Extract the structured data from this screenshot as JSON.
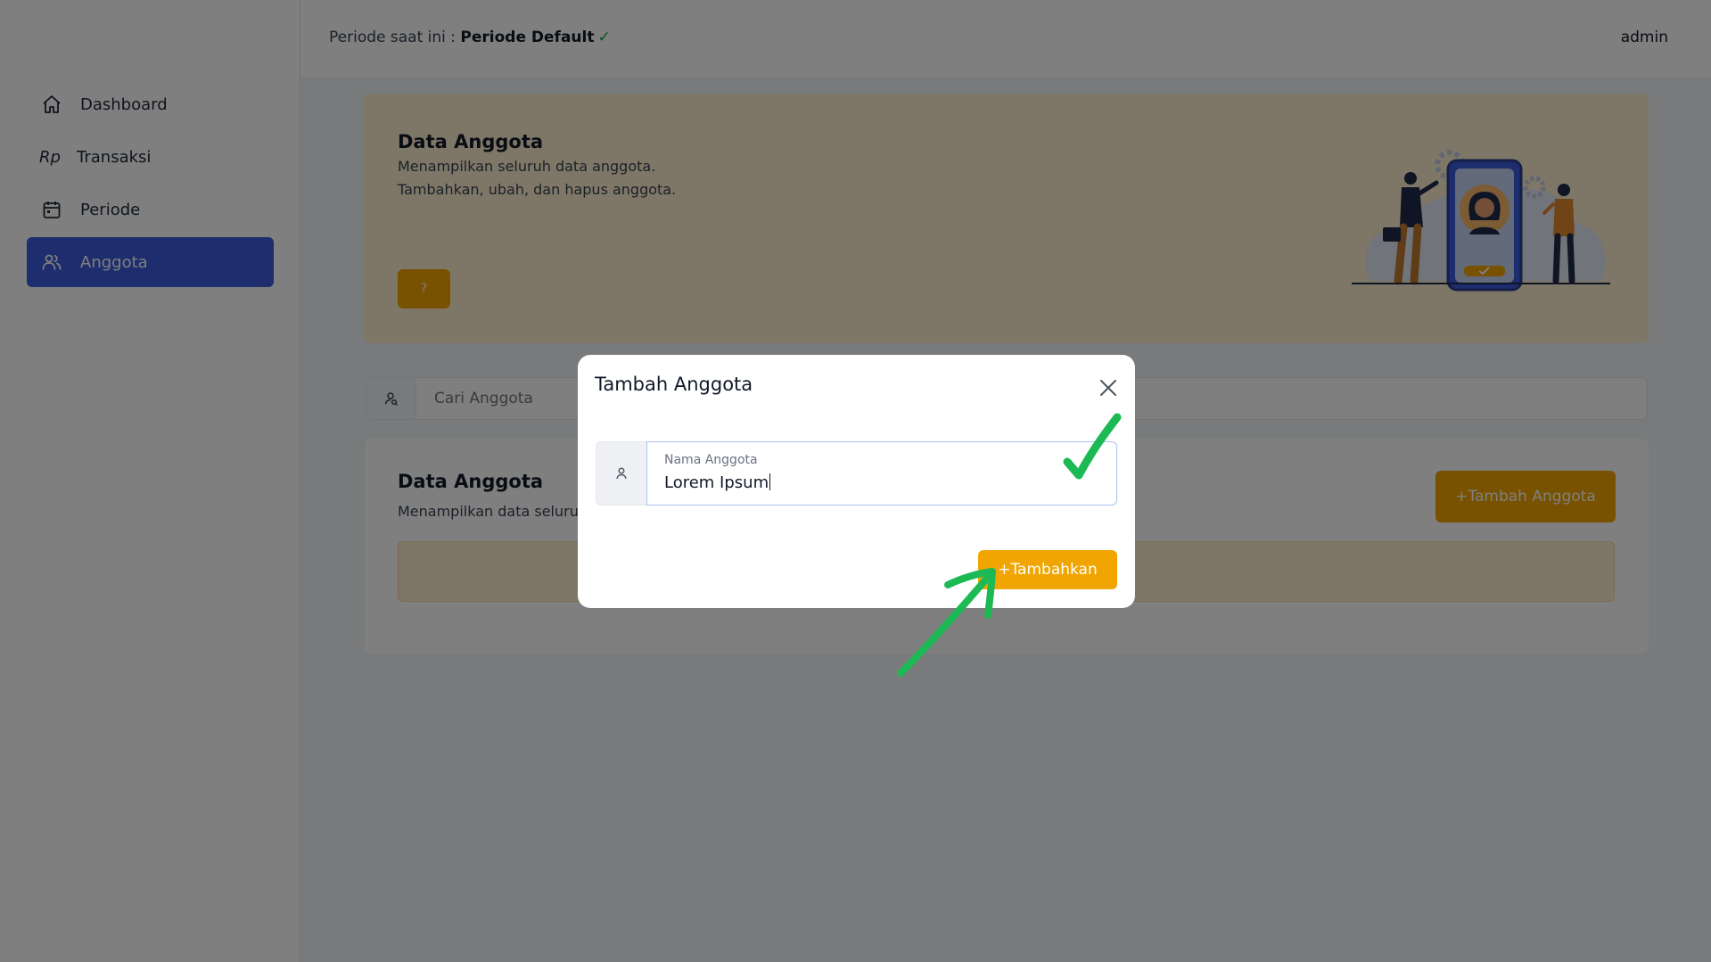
{
  "sidebar": {
    "items": [
      {
        "label": "Dashboard",
        "icon": "home-icon"
      },
      {
        "label": "Transaksi",
        "icon": "rupiah-icon",
        "glyph": "Rp"
      },
      {
        "label": "Periode",
        "icon": "calendar-icon"
      },
      {
        "label": "Anggota",
        "icon": "users-icon",
        "active": true
      }
    ]
  },
  "header": {
    "period_prefix": "Periode saat ini :",
    "period_name": "Periode Default",
    "period_check": "✓",
    "user": "admin"
  },
  "banner": {
    "title": "Data Anggota",
    "line1": "Menampilkan seluruh data anggota.",
    "line2": "Tambahkan, ubah, dan hapus anggota.",
    "help_label": "?"
  },
  "search": {
    "placeholder": "Cari Anggota"
  },
  "card": {
    "title": "Data Anggota",
    "subtitle": "Menampilkan data seluruh anggota",
    "add_label": "+Tambah Anggota"
  },
  "modal": {
    "title": "Tambah Anggota",
    "field_label": "Nama Anggota",
    "field_value": "Lorem Ipsum",
    "submit_label": "+Tambahkan"
  },
  "colors": {
    "primary": "#3b5bdb",
    "accent": "#f0a500",
    "banner_bg": "#fdeed0",
    "annotation": "#1db954"
  }
}
